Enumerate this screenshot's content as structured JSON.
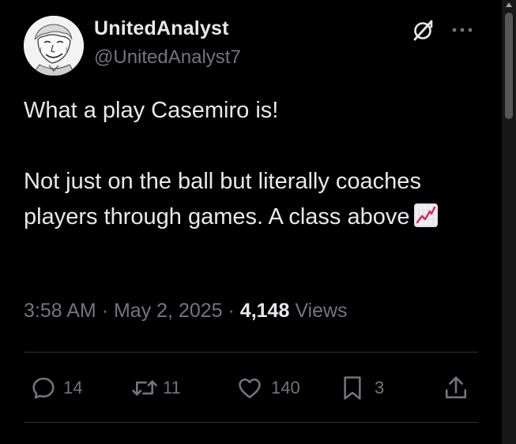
{
  "author": {
    "name": "UnitedAnalyst",
    "handle": "@UnitedAnalyst7",
    "avatar_icon": "avatar-portrait"
  },
  "header_icons": {
    "grok": "grok-icon",
    "more": "more-icon"
  },
  "tweet": {
    "line1": "What a play Casemiro is!",
    "line2": "Not just on the ball but literally coaches players through games. A class above",
    "emoji": "chart-increasing-emoji"
  },
  "meta": {
    "time": "3:58 AM",
    "separator": "·",
    "date": "May 2, 2025",
    "views_count": "4,148",
    "views_label": "Views"
  },
  "actions": {
    "replies": "14",
    "reposts": "11",
    "likes": "140",
    "bookmarks": "3"
  },
  "colors": {
    "background": "#000000",
    "text": "#e7e9ea",
    "muted": "#71767b",
    "divider": "#2f3336"
  }
}
